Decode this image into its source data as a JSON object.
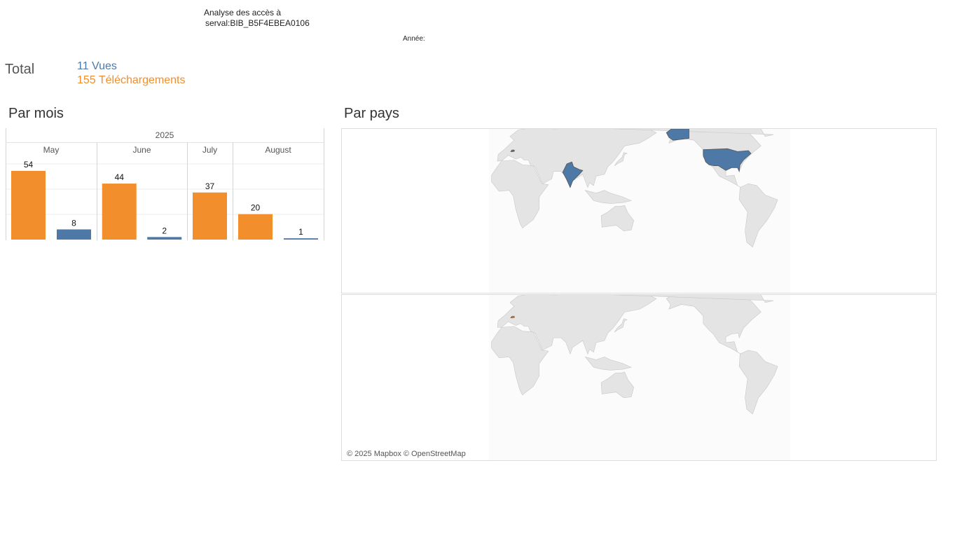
{
  "header": {
    "title_line1": "Analyse des accès à",
    "title_line2": "serval:BIB_B5F4EBEA0106",
    "annee_label": "Année:"
  },
  "total": {
    "label": "Total",
    "views": "11 Vues",
    "downloads": "155 Téléchargements"
  },
  "sections": {
    "by_month": "Par mois",
    "by_country": "Par pays"
  },
  "colors": {
    "views": "#4e79a7",
    "downloads": "#f28e2b",
    "land": "#e4e4e4",
    "border": "#c8c8c8"
  },
  "chart_data": {
    "type": "bar",
    "year": "2025",
    "categories": [
      "May",
      "June",
      "July",
      "August"
    ],
    "series": [
      {
        "key": "downloads",
        "values": [
          54,
          44,
          37,
          20
        ]
      },
      {
        "key": "views",
        "values": [
          8,
          2,
          null,
          1
        ]
      }
    ],
    "ylim": [
      0,
      60
    ],
    "grid": true
  },
  "map": {
    "credit": "© 2025 Mapbox © OpenStreetMap",
    "views_countries": [
      "United States",
      "India",
      "Switzerland"
    ],
    "downloads_countries": [
      "Switzerland"
    ]
  }
}
